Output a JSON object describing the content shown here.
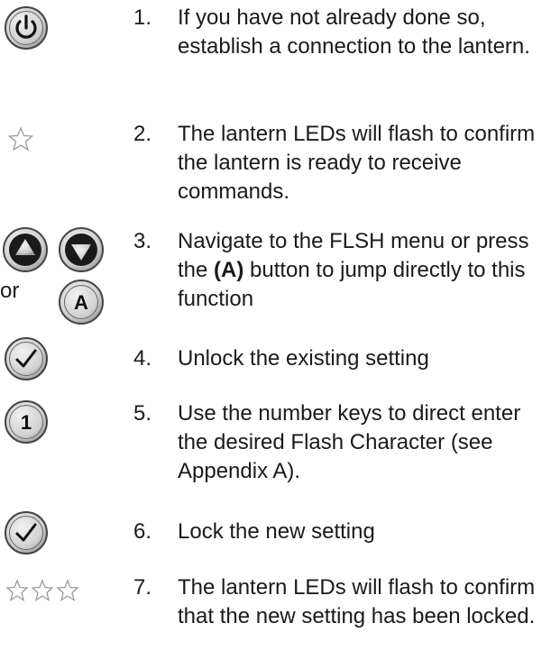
{
  "steps": [
    {
      "number": "1.",
      "text": "If you have not already done so, establish a connection to the lantern.",
      "icon": "power-button-icon"
    },
    {
      "number": "2.",
      "text": "The lantern LEDs will flash to confirm the lantern is ready to receive commands.",
      "icon": "star-icon"
    },
    {
      "number": "3.",
      "text_before": "Navigate to the FLSH menu or press the ",
      "text_bold": "(A)",
      "text_after": " button to jump directly to this function",
      "icons": [
        "up-arrow-button-icon",
        "down-arrow-button-icon",
        "a-button-icon"
      ],
      "or_label": "or",
      "a_label": "A"
    },
    {
      "number": "4.",
      "text": "Unlock the existing setting",
      "icon": "check-button-icon"
    },
    {
      "number": "5.",
      "text": "Use the number keys to direct enter the desired Flash Character (see Appendix A).",
      "icon": "one-button-icon",
      "key_label": "1"
    },
    {
      "number": "6.",
      "text": "Lock the new setting",
      "icon": "check-button-icon"
    },
    {
      "number": "7.",
      "text": "The lantern LEDs will flash to confirm that the new setting has been locked.",
      "icon": "three-stars-icon"
    }
  ]
}
